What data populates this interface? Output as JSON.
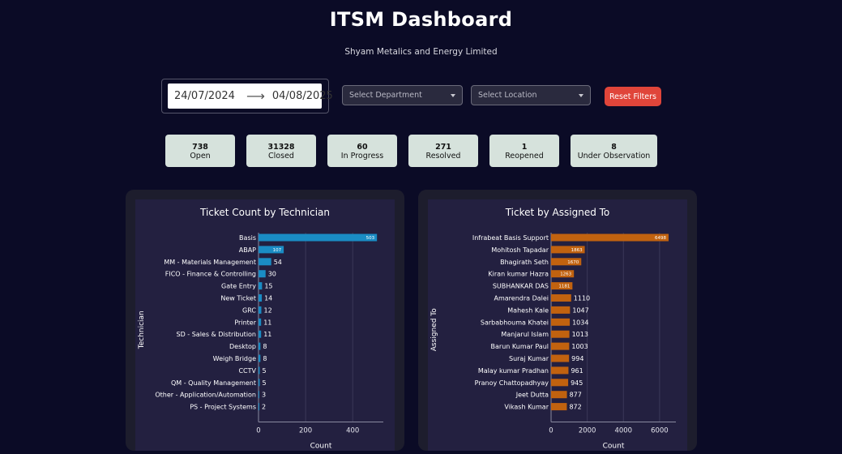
{
  "header": {
    "title": "ITSM Dashboard",
    "subtitle": "Shyam Metalics and Energy Limited"
  },
  "filters": {
    "start_date": "24/07/2024",
    "end_date": "04/08/2025",
    "department_placeholder": "Select Department",
    "location_placeholder": "Select Location",
    "reset_label": "Reset Filters"
  },
  "stats": [
    {
      "value": "738",
      "label": "Open"
    },
    {
      "value": "31328",
      "label": "Closed"
    },
    {
      "value": "60",
      "label": "In Progress"
    },
    {
      "value": "271",
      "label": "Resolved"
    },
    {
      "value": "1",
      "label": "Reopened"
    },
    {
      "value": "8",
      "label": "Under Observation"
    }
  ],
  "colors": {
    "background": "#0b0b26",
    "technician_bar": "#1a8cc4",
    "assigned_bar": "#c1620f",
    "reset_button": "#e0453a"
  },
  "chart_data": [
    {
      "type": "bar",
      "orientation": "horizontal",
      "title": "Ticket Count by Technician",
      "xlabel": "Count",
      "ylabel": "Technician",
      "xticks": [
        0,
        200,
        400
      ],
      "xlim": [
        0,
        530
      ],
      "categories": [
        "Basis",
        "ABAP",
        "MM - Materials Management",
        "FICO - Finance & Controlling",
        "Gate Entry",
        "New Ticket",
        "GRC",
        "Printer",
        "SD - Sales & Distribution",
        "Desktop",
        "Weigh Bridge",
        "CCTV",
        "QM - Quality Management",
        "Other - Application/Automation",
        "PS - Project Systems"
      ],
      "values": [
        503,
        107,
        54,
        30,
        15,
        14,
        12,
        11,
        11,
        8,
        8,
        5,
        5,
        3,
        2
      ],
      "labels": [
        "503",
        "107",
        "54",
        "30",
        "15",
        "14",
        "12",
        "11",
        "11",
        "8",
        "8",
        "5",
        "5",
        "3",
        "2"
      ]
    },
    {
      "type": "bar",
      "orientation": "horizontal",
      "title": "Ticket by Assigned To",
      "xlabel": "Count",
      "ylabel": "Assigned To",
      "xticks": [
        0,
        2000,
        4000,
        6000
      ],
      "xlim": [
        0,
        6900
      ],
      "categories": [
        "Infrabeat Basis Support",
        "Mohitosh Tapadar",
        "Bhagirath Seth",
        "Kiran kumar Hazra",
        "SUBHANKAR DAS",
        "Amarendra Dalei",
        "Mahesh Kale",
        "Sarbabhouma Khatei",
        "Manjarul Islam",
        "Barun Kumar Paul",
        "Suraj Kumar",
        "Malay kumar Pradhan",
        "Pranoy Chattopadhyay",
        "Jeet Dutta",
        "Vikash Kumar"
      ],
      "values": [
        6498,
        1863,
        1670,
        1263,
        1181,
        1110,
        1047,
        1034,
        1013,
        1003,
        994,
        961,
        945,
        877,
        872
      ],
      "labels": [
        "6498",
        "1863",
        "1670",
        "1263",
        "1181",
        "1110",
        "1047",
        "1034",
        "1013",
        "1003",
        "994",
        "961",
        "945",
        "877",
        "872"
      ]
    }
  ]
}
